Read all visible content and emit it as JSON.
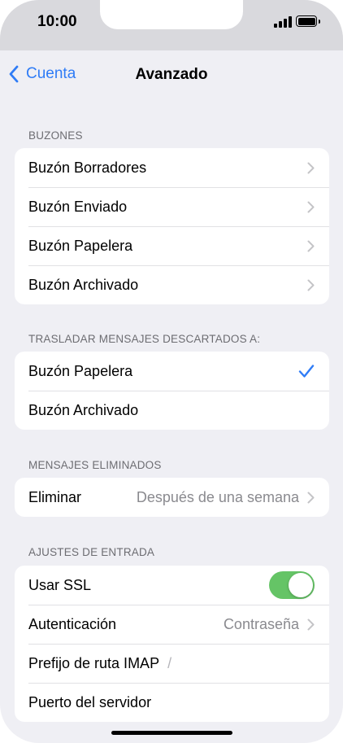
{
  "status_bar": {
    "time": "10:00"
  },
  "nav": {
    "back_label": "Cuenta",
    "title": "Avanzado"
  },
  "sections": {
    "mailboxes": {
      "header": "BUZONES",
      "rows": [
        {
          "label": "Buzón Borradores"
        },
        {
          "label": "Buzón Enviado"
        },
        {
          "label": "Buzón Papelera"
        },
        {
          "label": "Buzón Archivado"
        }
      ]
    },
    "move_discarded": {
      "header": "TRASLADAR MENSAJES DESCARTADOS A:",
      "rows": [
        {
          "label": "Buzón Papelera",
          "selected": true
        },
        {
          "label": "Buzón Archivado",
          "selected": false
        }
      ]
    },
    "deleted_messages": {
      "header": "MENSAJES ELIMINADOS",
      "rows": [
        {
          "label": "Eliminar",
          "value": "Después de una semana"
        }
      ]
    },
    "incoming_settings": {
      "header": "AJUSTES DE ENTRADA",
      "use_ssl": {
        "label": "Usar SSL",
        "enabled": true
      },
      "authentication": {
        "label": "Autenticación",
        "value": "Contraseña"
      },
      "imap_prefix": {
        "label": "Prefijo de ruta IMAP",
        "value": "/"
      },
      "server_port": {
        "label": "Puerto del servidor"
      }
    }
  },
  "colors": {
    "accent": "#2f7cf6",
    "toggle_on": "#65c466",
    "background": "#efeff4",
    "secondary_text": "#8a8a8f"
  }
}
